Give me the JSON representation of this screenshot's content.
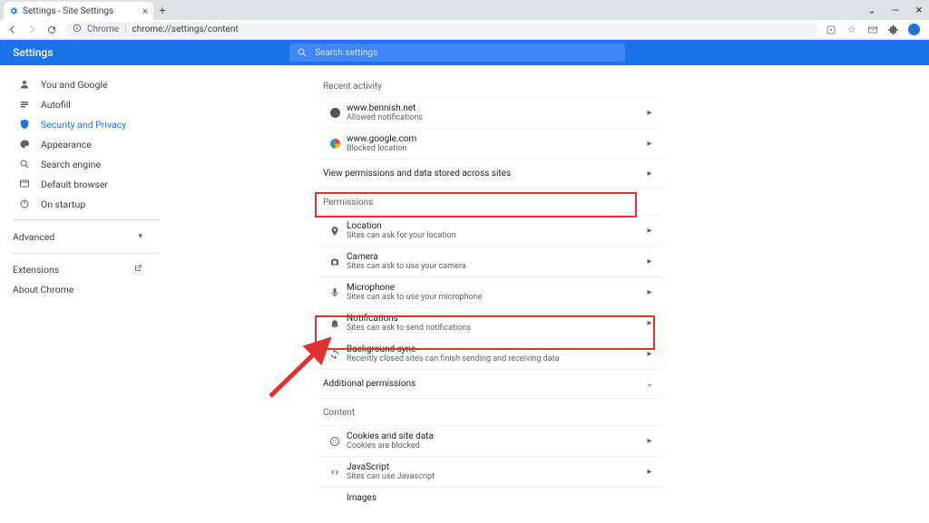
{
  "browser": {
    "tab_title": "Settings - Site Settings",
    "omnibox_prefix": "Chrome",
    "omnibox_path": "chrome://settings/content"
  },
  "header": {
    "title": "Settings",
    "search_placeholder": "Search settings"
  },
  "sidebar": {
    "items": [
      {
        "label": "You and Google"
      },
      {
        "label": "Autofill"
      },
      {
        "label": "Security and Privacy"
      },
      {
        "label": "Appearance"
      },
      {
        "label": "Search engine"
      },
      {
        "label": "Default browser"
      },
      {
        "label": "On startup"
      }
    ],
    "advanced": "Advanced",
    "extensions": "Extensions",
    "about": "About Chrome"
  },
  "content": {
    "recent_heading": "Recent activity",
    "recent": [
      {
        "title": "www.bennish.net",
        "sub": "Allowed notifications"
      },
      {
        "title": "www.google.com",
        "sub": "Blocked location"
      }
    ],
    "view_all": "View permissions and data stored across sites",
    "permissions_heading": "Permissions",
    "permissions": [
      {
        "title": "Location",
        "sub": "Sites can ask for your location"
      },
      {
        "title": "Camera",
        "sub": "Sites can ask to use your camera"
      },
      {
        "title": "Microphone",
        "sub": "Sites can ask to use your microphone"
      },
      {
        "title": "Notifications",
        "sub": "Sites can ask to send notifications"
      },
      {
        "title": "Background sync",
        "sub": "Recently closed sites can finish sending and receiving data"
      }
    ],
    "additional": "Additional permissions",
    "content_heading": "Content",
    "content_items": [
      {
        "title": "Cookies and site data",
        "sub": "Cookies are blocked"
      },
      {
        "title": "JavaScript",
        "sub": "Sites can use Javascript"
      },
      {
        "title": "Images",
        "sub": ""
      }
    ]
  }
}
